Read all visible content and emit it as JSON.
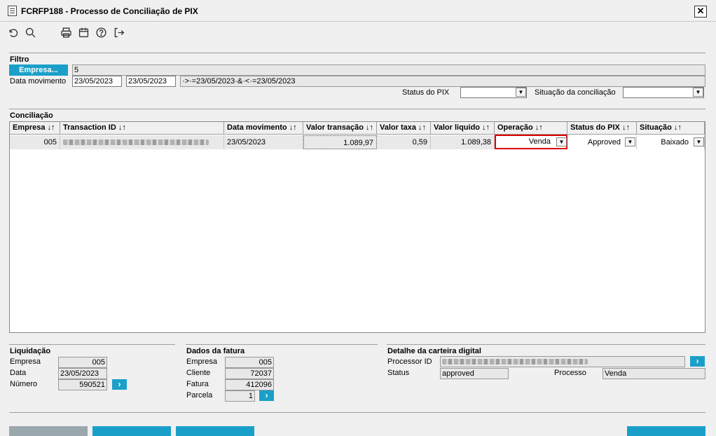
{
  "window": {
    "title": "FCRFP188 - Processo de Conciliação de PIX",
    "close_glyph": "✕"
  },
  "toolbar": {
    "icons": [
      "undo-icon",
      "search-icon",
      "print-icon",
      "calendar-icon",
      "help-icon",
      "exit-icon"
    ]
  },
  "filtro": {
    "title": "Filtro",
    "empresa_button": "Empresa...",
    "empresa_value": "5",
    "data_movimento_label": "Data movimento",
    "data_inicio": "23/05/2023",
    "data_fim": "23/05/2023",
    "data_expr": "·>·=23/05/2023·&·<·=23/05/2023",
    "status_pix_label": "Status do PIX",
    "status_pix_value": "",
    "situacao_label": "Situação da conciliação",
    "situacao_value": ""
  },
  "conciliacao": {
    "title": "Conciliação",
    "columns": [
      "Empresa ↓↑",
      "Transaction ID ↓↑",
      "Data movimento ↓↑",
      "Valor transação ↓↑",
      "Valor taxa ↓↑",
      "Valor liquido ↓↑",
      "Operação ↓↑",
      "Status do PIX ↓↑",
      "Situação ↓↑"
    ],
    "rows": [
      {
        "empresa": "005",
        "data_movimento": "23/05/2023",
        "valor_transacao": "1.089,97",
        "valor_taxa": "0,59",
        "valor_liquido": "1.089,38",
        "operacao": "Venda",
        "status_pix": "Approved",
        "situacao": "Baixado"
      }
    ]
  },
  "liquidacao": {
    "title": "Liquidação",
    "empresa_label": "Empresa",
    "empresa": "005",
    "data_label": "Data",
    "data": "23/05/2023",
    "numero_label": "Número",
    "numero": "590521"
  },
  "fatura": {
    "title": "Dados da fatura",
    "empresa_label": "Empresa",
    "empresa": "005",
    "cliente_label": "Cliente",
    "cliente": "72037",
    "fatura_label": "Fatura",
    "fatura": "412096",
    "parcela_label": "Parcela",
    "parcela": "1"
  },
  "carteira": {
    "title": "Detalhe da carteira digital",
    "processor_label": "Processor ID",
    "status_label": "Status",
    "status": "approved",
    "processo_label": "Processo",
    "processo": "Venda"
  },
  "colors": {
    "accent": "#1aa0c8",
    "highlight_border": "#e00000"
  }
}
